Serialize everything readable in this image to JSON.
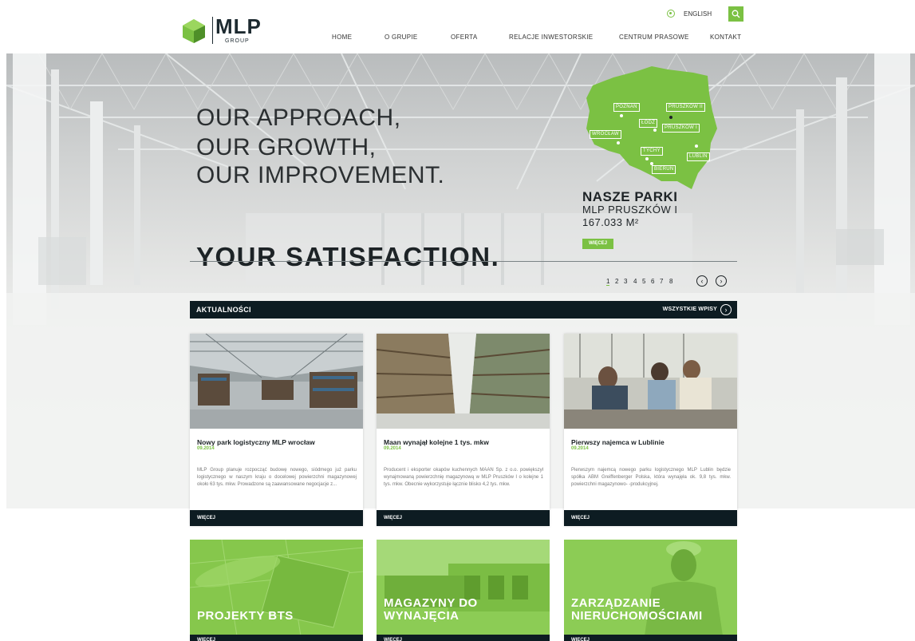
{
  "header": {
    "logo_name": "MLP",
    "logo_sub": "GROUP",
    "language": "ENGLISH",
    "nav": [
      "HOME",
      "O GRUPIE",
      "OFERTA",
      "RELACJE INWESTORSKIE",
      "CENTRUM PRASOWE",
      "KONTAKT"
    ],
    "brand_color": "#7bc143"
  },
  "hero": {
    "lines": [
      "OUR APPROACH,",
      "OUR GROWTH,",
      "OUR IMPROVEMENT."
    ],
    "bold_line": "YOUR SATISFACTION.",
    "map_cities": [
      "POZNAŃ",
      "PRUSZKÓW II",
      "ŁÓDŹ",
      "PRUSZKÓW I",
      "WROCŁAW",
      "TYCHY",
      "LUBLIN",
      "BIERUŃ"
    ],
    "park_title": "NASZE PARKI",
    "park_name": "MLP PRUSZKÓW I",
    "park_area": "167.033 M²",
    "park_button": "WIĘCEJ",
    "pages": [
      "1",
      "2",
      "3",
      "4",
      "5",
      "6",
      "7",
      "8"
    ],
    "active_page": "1"
  },
  "news": {
    "title": "AKTUALNOŚCI",
    "all_label": "WSZYSTKIE WPISY",
    "items": [
      {
        "title": "Nowy park logistyczny MLP wrocław",
        "date": "09.2014",
        "text": "MLP Group planuje rozpocząć budowę nowego, siódmego już parku logistycznego w naszym kraju o docelowej powierzchni magazynowej około 63 tys. mkw. Prowadzone są zaawansowane negocjacje z...",
        "more": "WIĘCEJ"
      },
      {
        "title": "Maan wynajął kolejne 1 tys. mkw",
        "date": "09.2014",
        "text": "Producent i eksporter okapów kuchennych MAAN Sp. z o.o. powiększył wynajmowaną powierzchnię magazynową w MLP Pruszków I o kolejne 1 tys. mkw. Obecnie wykorzystuje łącznie blisko 4,2 tys. mkw.",
        "more": "WIĘCEJ"
      },
      {
        "title": "Pierwszy najemca w Lublinie",
        "date": "09.2014",
        "text": "Pierwszym najemcą nowego parku logistycznego MLP Lublin będzie spółka ABM Greiffenberger Polska, która wynajęła ok. 9,8 tys. mkw. powierzchni magazynowo- -produkcyjnej.",
        "more": "WIĘCEJ"
      }
    ]
  },
  "tiles": [
    {
      "line1": "PROJEKTY BTS",
      "line2": "",
      "more": "WIĘCEJ"
    },
    {
      "line1": "MAGAZYNY DO",
      "line2": "WYNAJĘCIA",
      "more": "WIĘCEJ"
    },
    {
      "line1": "ZARZĄDZANIE",
      "line2": "NIERUCHOMOŚCIAMI",
      "more": "WIĘCEJ"
    }
  ]
}
